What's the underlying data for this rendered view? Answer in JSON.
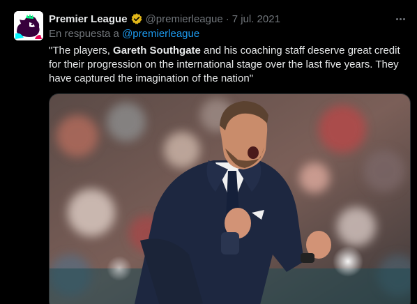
{
  "author": {
    "display_name": "Premier League",
    "handle": "@premierleague",
    "date": "7 jul. 2021",
    "verified_badge_color": "#e2b719"
  },
  "reply": {
    "prefix": "En respuesta a",
    "mention": "@premierleague"
  },
  "tweet": {
    "text_part1": "\"The players, ",
    "text_bold": "Gareth Southgate",
    "text_part2": " and his coaching staff deserve great credit for their progression on the international stage over the last five years. They have captured the imagination of the nation\""
  },
  "icons": {
    "avatar": "premier-league-lion-logo",
    "verified": "gold-verified-badge-icon",
    "more": "more-options-icon"
  },
  "colors": {
    "background": "#000000",
    "text": "#e7e9ea",
    "secondary": "#71767b",
    "link": "#1d9bf0"
  }
}
